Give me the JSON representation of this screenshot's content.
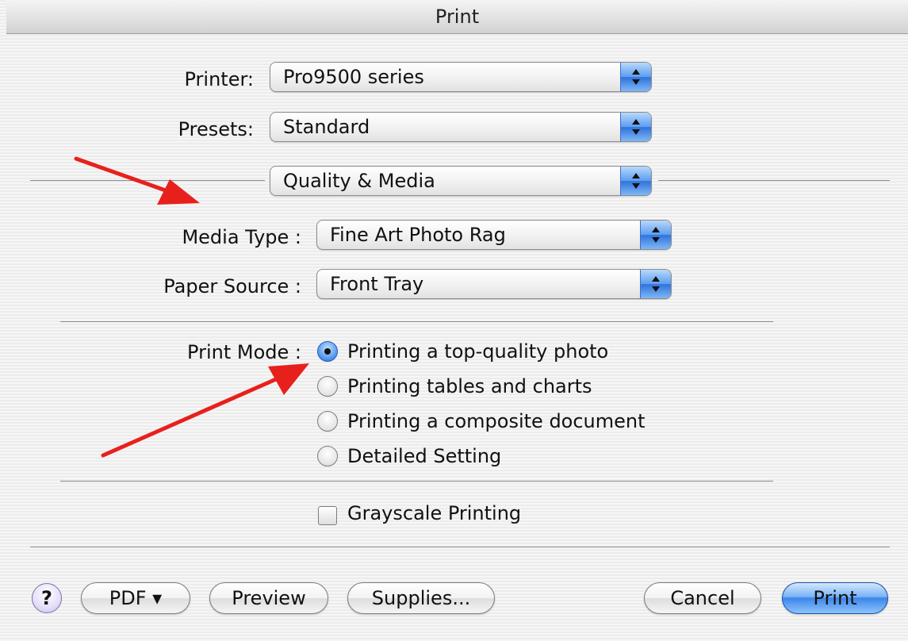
{
  "window": {
    "title": "Print"
  },
  "printer": {
    "label": "Printer:",
    "value": "Pro9500 series"
  },
  "presets": {
    "label": "Presets:",
    "value": "Standard"
  },
  "panel": {
    "value": "Quality & Media"
  },
  "media_type": {
    "label": "Media Type :",
    "value": "Fine Art Photo Rag"
  },
  "paper_source": {
    "label": "Paper Source :",
    "value": "Front Tray"
  },
  "print_mode": {
    "label": "Print Mode :",
    "selected_index": 0,
    "options": [
      "Printing a top-quality photo",
      "Printing tables and charts",
      "Printing a composite document",
      "Detailed Setting"
    ]
  },
  "grayscale": {
    "label": "Grayscale Printing",
    "checked": false
  },
  "buttons": {
    "help": "?",
    "pdf": "PDF ▾",
    "preview": "Preview",
    "supplies": "Supplies...",
    "cancel": "Cancel",
    "print": "Print"
  },
  "colors": {
    "accent_blue": "#3c86ea",
    "annotation_arrow": "#e8201c",
    "background": "#ececec"
  },
  "icons": {
    "popup_arrows": "up-down-arrows-icon",
    "annotation": "red-arrow-icon"
  }
}
